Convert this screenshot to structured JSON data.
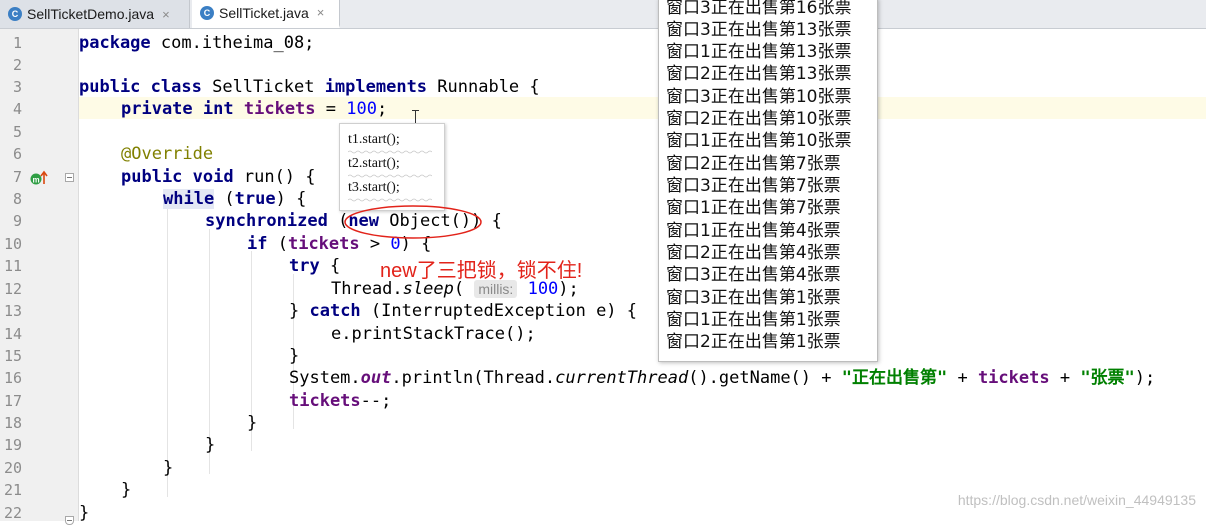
{
  "tabs": [
    {
      "label": "SellTicketDemo.java",
      "icon": "class-c-icon"
    },
    {
      "label": "SellTicket.java",
      "icon": "class-c-icon"
    }
  ],
  "line_numbers": [
    "1",
    "2",
    "3",
    "4",
    "5",
    "6",
    "7",
    "8",
    "9",
    "10",
    "11",
    "12",
    "13",
    "14",
    "15",
    "16",
    "17",
    "18",
    "19",
    "20",
    "21",
    "22"
  ],
  "code": {
    "l1_kw": "package",
    "l1_rest": " com.itheima_08;",
    "l3_kw1": "public",
    "l3_kw2": "class",
    "l3_name": " SellTicket ",
    "l3_kw3": "implements",
    "l3_rest": " Runnable {",
    "l4_kw1": "private",
    "l4_kw2": "int",
    "l4_fld": "tickets",
    "l4_eq": " = ",
    "l4_num": "100",
    "l4_end": ";",
    "l6_ann": "@Override",
    "l7_kw1": "public",
    "l7_kw2": "void",
    "l7_rest": " run() {",
    "l8_kw": "while",
    "l8_mid": " (",
    "l8_kw2": "true",
    "l8_end": ") {",
    "l9_kw": "synchronized",
    "l9_mid": " (",
    "l9_kw2": "new",
    "l9_end": " Object()) {",
    "l10_kw": "if",
    "l10_mid": " (",
    "l10_fld": "tickets",
    "l10_op": " > ",
    "l10_num": "0",
    "l10_end": ") {",
    "l11_kw": "try",
    "l11_end": " {",
    "l12_pre": "Thread.",
    "l12_method": "sleep",
    "l12_open": "( ",
    "l12_hint": "millis:",
    "l12_num": "100",
    "l12_end": ");",
    "l13_pre": "} ",
    "l13_kw": "catch",
    "l13_rest": " (InterruptedException e) {",
    "l14": "e.printStackTrace();",
    "l15": "}",
    "l16_pre": "System.",
    "l16_out": "out",
    "l16_mid": ".println(Thread.",
    "l16_ct": "currentThread",
    "l16_mid2": "().getName() + ",
    "l16_str1": "\"正在出售第\"",
    "l16_plus": " + ",
    "l16_fld": "tickets",
    "l16_plus2": " + ",
    "l16_str2": "\"张票\"",
    "l16_end": ");",
    "l17_fld": "tickets",
    "l17_end": "--;",
    "l18": "}",
    "l19": "}",
    "l20": "}",
    "l21": "}",
    "l22": "}"
  },
  "popup": [
    "t1.start();",
    "t2.start();",
    "t3.start();"
  ],
  "annotation": "new了三把锁，锁不住!",
  "console": [
    "窗口3正在出售第16张票",
    "窗口3正在出售第13张票",
    "窗口1正在出售第13张票",
    "窗口2正在出售第13张票",
    "窗口3正在出售第10张票",
    "窗口2正在出售第10张票",
    "窗口1正在出售第10张票",
    "窗口2正在出售第7张票",
    "窗口3正在出售第7张票",
    "窗口1正在出售第7张票",
    "窗口1正在出售第4张票",
    "窗口2正在出售第4张票",
    "窗口3正在出售第4张票",
    "窗口3正在出售第1张票",
    "窗口1正在出售第1张票",
    "窗口2正在出售第1张票"
  ],
  "watermark": "https://blog.csdn.net/weixin_44949135",
  "colors": {
    "keyword": "#000080",
    "number": "#0000ff",
    "string": "#008000",
    "field": "#660e7a",
    "annotation_red": "#e2231a"
  }
}
